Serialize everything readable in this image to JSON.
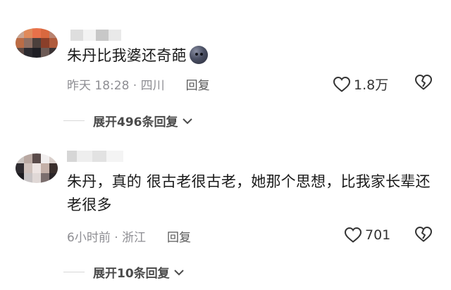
{
  "comments": [
    {
      "text": "朱丹比我婆还奇葩",
      "time": "昨天 18:28 · 四川",
      "reply_label": "回复",
      "like_count": "1.8万",
      "expand_label": "展开496条回复"
    },
    {
      "text": "朱丹，真的 很古老很古老，她那个思想，比我家长辈还老很多",
      "time": "6小时前 · 浙江",
      "reply_label": "回复",
      "like_count": "701",
      "expand_label": "展开10条回复"
    }
  ],
  "colors": {
    "muted": "#8e8e93",
    "text": "#1a1a1a"
  },
  "icons": {
    "like": "heart-outline-icon",
    "dislike": "broken-heart-icon",
    "expand": "chevron-down-icon"
  }
}
